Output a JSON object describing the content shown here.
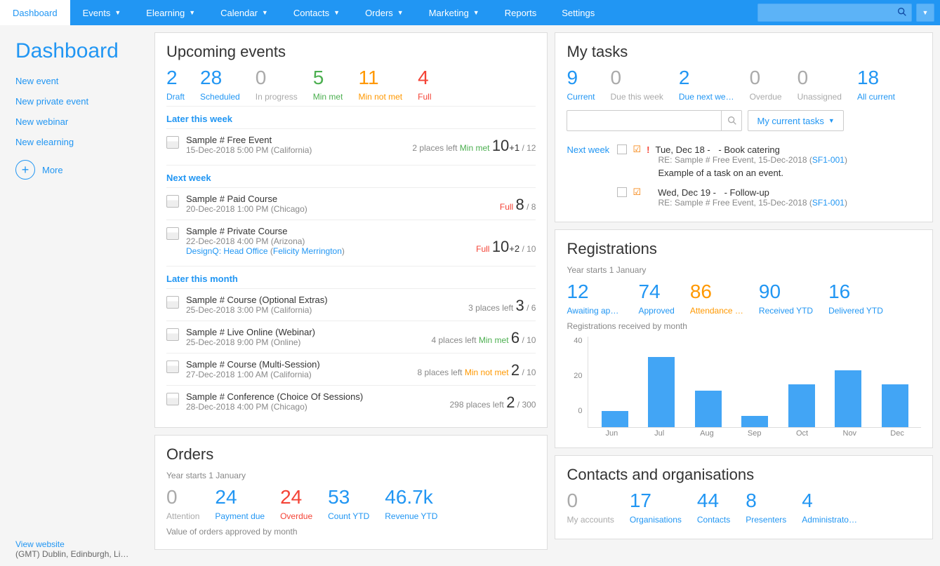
{
  "nav": {
    "items": [
      "Dashboard",
      "Events",
      "Elearning",
      "Calendar",
      "Contacts",
      "Orders",
      "Marketing",
      "Reports",
      "Settings"
    ],
    "has_caret": [
      false,
      true,
      true,
      true,
      true,
      true,
      true,
      false,
      false
    ],
    "active_index": 0
  },
  "sidebar": {
    "title": "Dashboard",
    "links": [
      "New event",
      "New private event",
      "New webinar",
      "New elearning"
    ],
    "more": "More",
    "footer_link": "View website",
    "footer_tz": "(GMT) Dublin, Edinburgh, Li…"
  },
  "upcoming": {
    "heading": "Upcoming events",
    "stats": [
      {
        "num": "2",
        "lbl": "Draft",
        "cls": "c-blue"
      },
      {
        "num": "28",
        "lbl": "Scheduled",
        "cls": "c-blue"
      },
      {
        "num": "0",
        "lbl": "In progress",
        "cls": "c-grey"
      },
      {
        "num": "5",
        "lbl": "Min met",
        "cls": "c-green"
      },
      {
        "num": "11",
        "lbl": "Min not met",
        "cls": "c-orange"
      },
      {
        "num": "4",
        "lbl": "Full",
        "cls": "c-red"
      }
    ],
    "groups": [
      {
        "label": "Later this week",
        "events": [
          {
            "title": "Sample # Free Event",
            "meta": "15-Dec-2018 5:00 PM (California)",
            "left": "2 places left",
            "status": "Min met",
            "status_cls": "c-green",
            "big": "10",
            "extra": "+1",
            "total": "/ 12"
          }
        ]
      },
      {
        "label": "Next week",
        "events": [
          {
            "title": "Sample # Paid Course",
            "meta": "20-Dec-2018 1:00 PM (Chicago)",
            "left": "",
            "status": "Full",
            "status_cls": "c-red",
            "big": "8",
            "extra": "",
            "total": "/ 8"
          },
          {
            "title": "Sample # Private Course",
            "meta": "22-Dec-2018 4:00 PM (Arizona)",
            "link": "DesignQ: Head Office",
            "link2": "Felicity Merrington",
            "left": "",
            "status": "Full",
            "status_cls": "c-red",
            "big": "10",
            "extra": "+2",
            "total": "/ 10"
          }
        ]
      },
      {
        "label": "Later this month",
        "events": [
          {
            "title": "Sample # Course (Optional Extras)",
            "meta": "25-Dec-2018 3:00 PM (California)",
            "left": "3 places left",
            "status": "",
            "status_cls": "",
            "big": "3",
            "extra": "",
            "total": "/ 6"
          },
          {
            "title": "Sample # Live Online (Webinar)",
            "meta": "25-Dec-2018 9:00 PM (Online)",
            "left": "4 places left",
            "status": "Min met",
            "status_cls": "c-green",
            "big": "6",
            "extra": "",
            "total": "/ 10"
          },
          {
            "title": "Sample # Course (Multi-Session)",
            "meta": "27-Dec-2018 1:00 AM (California)",
            "left": "8 places left",
            "status": "Min not met",
            "status_cls": "c-orange",
            "big": "2",
            "extra": "",
            "total": "/ 10"
          },
          {
            "title": "Sample # Conference (Choice Of Sessions)",
            "meta": "28-Dec-2018 4:00 PM (Chicago)",
            "left": "298 places left",
            "status": "",
            "status_cls": "",
            "big": "2",
            "extra": "",
            "total": "/ 300"
          }
        ]
      }
    ]
  },
  "orders": {
    "heading": "Orders",
    "sub": "Year starts 1 January",
    "stats": [
      {
        "num": "0",
        "lbl": "Attention",
        "cls": "c-grey"
      },
      {
        "num": "24",
        "lbl": "Payment due",
        "cls": "c-blue"
      },
      {
        "num": "24",
        "lbl": "Overdue",
        "cls": "c-red"
      },
      {
        "num": "53",
        "lbl": "Count YTD",
        "cls": "c-blue"
      },
      {
        "num": "46.7k",
        "lbl": "Revenue YTD",
        "cls": "c-blue"
      }
    ],
    "chart_title": "Value of orders approved by month"
  },
  "tasks": {
    "heading": "My tasks",
    "stats": [
      {
        "num": "9",
        "lbl": "Current",
        "cls": "c-blue"
      },
      {
        "num": "0",
        "lbl": "Due this week",
        "cls": "c-grey"
      },
      {
        "num": "2",
        "lbl": "Due next we…",
        "cls": "c-blue"
      },
      {
        "num": "0",
        "lbl": "Overdue",
        "cls": "c-grey"
      },
      {
        "num": "0",
        "lbl": "Unassigned",
        "cls": "c-grey"
      },
      {
        "num": "18",
        "lbl": "All current",
        "cls": "c-blue"
      }
    ],
    "filter_label": "My current tasks",
    "items": [
      {
        "prefix": "Next week",
        "alert": true,
        "date": "Tue, Dec 18 -",
        "title": "- Book catering",
        "re": "RE: Sample # Free Event, 15-Dec-2018 (",
        "ref": "SF1-001",
        "desc": "Example of a task on an event."
      },
      {
        "prefix": "",
        "alert": false,
        "date": "Wed, Dec 19 -",
        "title": "- Follow-up",
        "re": "RE: Sample # Free Event, 15-Dec-2018 (",
        "ref": "SF1-001",
        "desc": ""
      }
    ]
  },
  "registrations": {
    "heading": "Registrations",
    "sub": "Year starts 1 January",
    "stats": [
      {
        "num": "12",
        "lbl": "Awaiting app…",
        "cls": "c-blue"
      },
      {
        "num": "74",
        "lbl": "Approved",
        "cls": "c-blue"
      },
      {
        "num": "86",
        "lbl": "Attendance …",
        "cls": "c-orange"
      },
      {
        "num": "90",
        "lbl": "Received YTD",
        "cls": "c-blue"
      },
      {
        "num": "16",
        "lbl": "Delivered YTD",
        "cls": "c-blue"
      }
    ],
    "chart_title": "Registrations received by month"
  },
  "contacts": {
    "heading": "Contacts and organisations",
    "stats": [
      {
        "num": "0",
        "lbl": "My accounts",
        "cls": "c-grey"
      },
      {
        "num": "17",
        "lbl": "Organisations",
        "cls": "c-blue"
      },
      {
        "num": "44",
        "lbl": "Contacts",
        "cls": "c-blue"
      },
      {
        "num": "8",
        "lbl": "Presenters",
        "cls": "c-blue"
      },
      {
        "num": "4",
        "lbl": "Administrato…",
        "cls": "c-blue"
      }
    ]
  },
  "chart_data": {
    "type": "bar",
    "categories": [
      "Jun",
      "Jul",
      "Aug",
      "Sep",
      "Oct",
      "Nov",
      "Dec"
    ],
    "values": [
      7,
      31,
      16,
      5,
      19,
      25,
      19
    ],
    "ylim": [
      0,
      40
    ],
    "yticks": [
      40,
      20,
      0
    ],
    "title": "Registrations received by month"
  }
}
